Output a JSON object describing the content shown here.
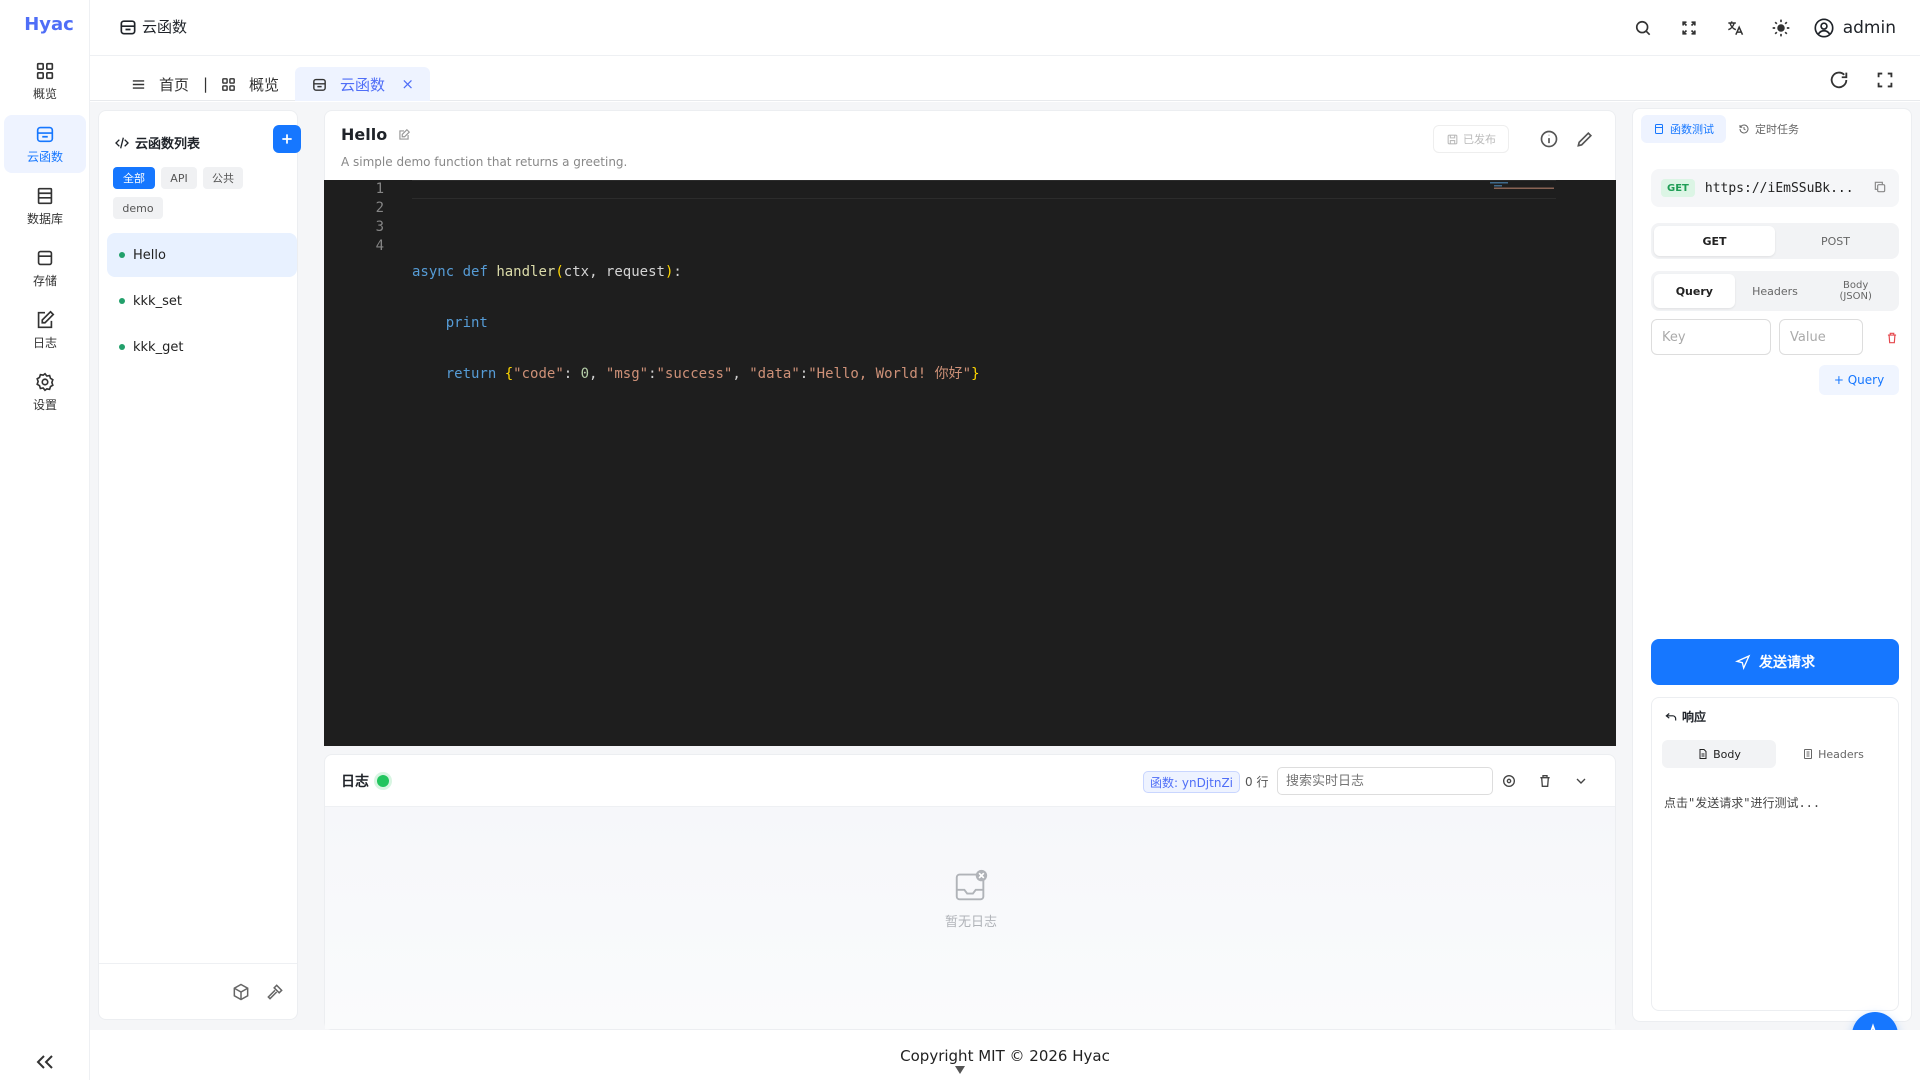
{
  "app": {
    "logo": "Hyac"
  },
  "sidebar": {
    "items": [
      {
        "label": "概览",
        "icon": "dashboard-icon"
      },
      {
        "label": "云函数",
        "icon": "cloud-function-icon",
        "active": true
      },
      {
        "label": "数据库",
        "icon": "database-icon"
      },
      {
        "label": "存储",
        "icon": "storage-icon"
      },
      {
        "label": "日志",
        "icon": "log-edit-icon"
      },
      {
        "label": "设置",
        "icon": "gear-icon"
      }
    ]
  },
  "header": {
    "breadcrumb": "云函数",
    "user": "admin"
  },
  "tabs": {
    "items": [
      {
        "label": "首页",
        "icon": "menu-icon"
      },
      {
        "label": "概览",
        "icon": "dashboard-icon"
      },
      {
        "label": "云函数",
        "icon": "cloud-function-icon",
        "active": true
      }
    ]
  },
  "function_list": {
    "title": "云函数列表",
    "filters": [
      "全部",
      "API",
      "公共",
      "demo"
    ],
    "active_filter": "全部",
    "items": [
      {
        "name": "Hello",
        "status": "published",
        "active": true
      },
      {
        "name": "kkk_set",
        "status": "published"
      },
      {
        "name": "kkk_get",
        "status": "published"
      }
    ]
  },
  "editor": {
    "function_name": "Hello",
    "description": "A simple demo function that returns a greeting.",
    "publish_status": "已发布",
    "line_numbers": [
      "1",
      "2",
      "3",
      "4"
    ],
    "code": {
      "line2": {
        "kw1": "async",
        "kw2": "def",
        "fn": "handler",
        "open": "(",
        "params": "ctx, request",
        "close": ")",
        "colon": ":"
      },
      "line3": {
        "text": "print"
      },
      "line4": {
        "kw": "return",
        "ob": "{",
        "k1": "\"code\"",
        "sep1": ": ",
        "v1": "0",
        "c1": ", ",
        "k2": "\"msg\"",
        "sep2": ":",
        "v2": "\"success\"",
        "c2": ", ",
        "k3": "\"data\"",
        "sep3": ":",
        "v3": "\"Hello, World! 你好\"",
        "cb": "}"
      }
    }
  },
  "logs": {
    "title": "日志",
    "function_tag": "函数: ynDjtnZi",
    "row_count": "0 行",
    "search_placeholder": "搜索实时日志",
    "empty_text": "暂无日志"
  },
  "test_panel": {
    "tabs": [
      "函数测试",
      "定时任务"
    ],
    "method_badge": "GET",
    "url": "https://iEmSSuBk...",
    "methods": [
      "GET",
      "POST"
    ],
    "active_method": "GET",
    "param_tabs": [
      "Query",
      "Headers",
      "Body\n(JSON)"
    ],
    "active_param_tab": "Query",
    "key_placeholder": "Key",
    "value_placeholder": "Value",
    "add_query_label": "+ Query",
    "send_label": "发送请求",
    "response_title": "响应",
    "response_tabs": [
      "Body",
      "Headers"
    ],
    "response_hint": "点击\"发送请求\"进行测试..."
  },
  "footer": {
    "text": "Copyright MIT © 2026 Hyac"
  },
  "colors": {
    "primary": "#1677ff",
    "editor_bg": "#1e1e1e",
    "status_green": "#22c55e"
  }
}
